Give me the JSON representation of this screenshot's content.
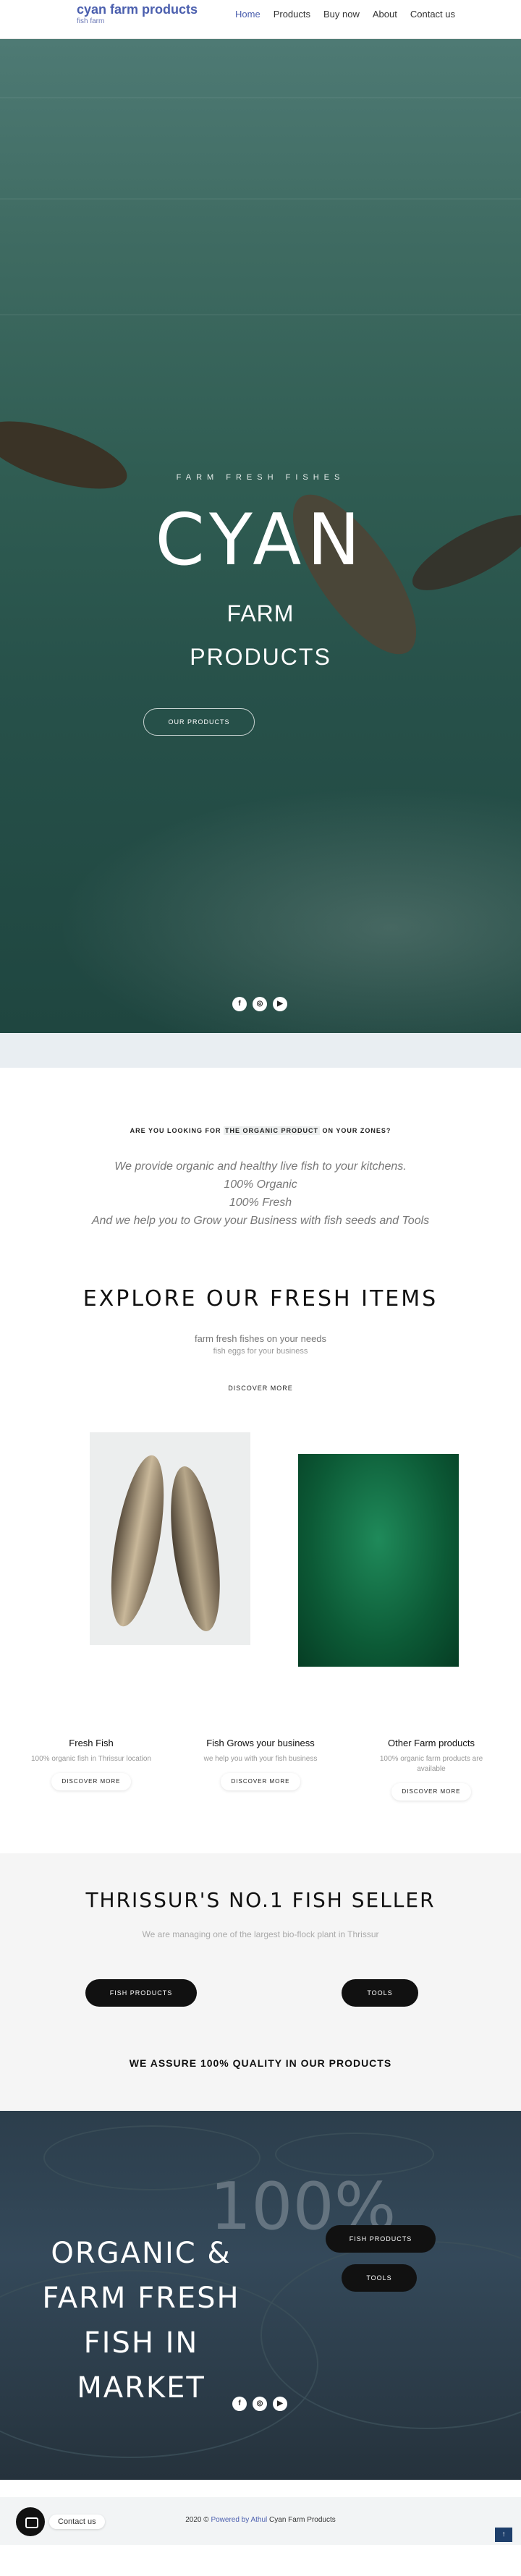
{
  "header": {
    "title": "cyan farm products",
    "subtitle": "fish farm",
    "nav": [
      "Home",
      "Products",
      "Buy now",
      "About",
      "Contact us"
    ]
  },
  "hero": {
    "kicker": "FARM FRESH FISHES",
    "title": "CYAN",
    "line1": "FARM",
    "line2": "PRODUCTS",
    "button": "OUR PRODUCTS",
    "socials": [
      "facebook-icon",
      "instagram-icon",
      "youtube-icon"
    ]
  },
  "intro": {
    "question_pre": "ARE YOU LOOKING FOR ",
    "question_hl": "THE ORGANIC PRODUCT",
    "question_post": " ON YOUR ZONES?",
    "lines": [
      "We provide organic and healthy live fish to your kitchens.",
      "100% Organic",
      "100% Fresh",
      "And we help you to Grow your Business with fish seeds and Tools"
    ]
  },
  "explore": {
    "title": "EXPLORE OUR FRESH ITEMS",
    "sub1": "farm fresh fishes on your needs",
    "sub2": "fish eggs for your business",
    "link": "DISCOVER MORE"
  },
  "cards": [
    {
      "title": "Fresh Fish",
      "text": "100% organic fish in Thrissur location",
      "button": "DISCOVER MORE"
    },
    {
      "title": "Fish Grows your business",
      "text": "we help you with your fish business",
      "button": "DISCOVER MORE"
    },
    {
      "title": "Other Farm products",
      "text": "100% organic farm products are available",
      "button": "DISCOVER MORE"
    }
  ],
  "seller": {
    "title": "THRISSUR'S NO.1 FISH SELLER",
    "text": "We are managing one of the largest bio-flock plant in Thrissur",
    "btn_left": "FISH PRODUCTS",
    "btn_right": "TOOLS",
    "assure": "WE ASSURE 100% QUALITY IN OUR PRODUCTS"
  },
  "market": {
    "big": "100%",
    "title_lines": [
      "ORGANIC &",
      "FARM FRESH",
      "FISH IN MARKET"
    ],
    "btn1": "FISH PRODUCTS",
    "btn2": "TOOLS"
  },
  "footer": {
    "year": "2020 ©",
    "powered": "Powered by Athul",
    "brand": "Cyan Farm Products",
    "chat_label": "Contact us",
    "top_arrow": "↑"
  }
}
